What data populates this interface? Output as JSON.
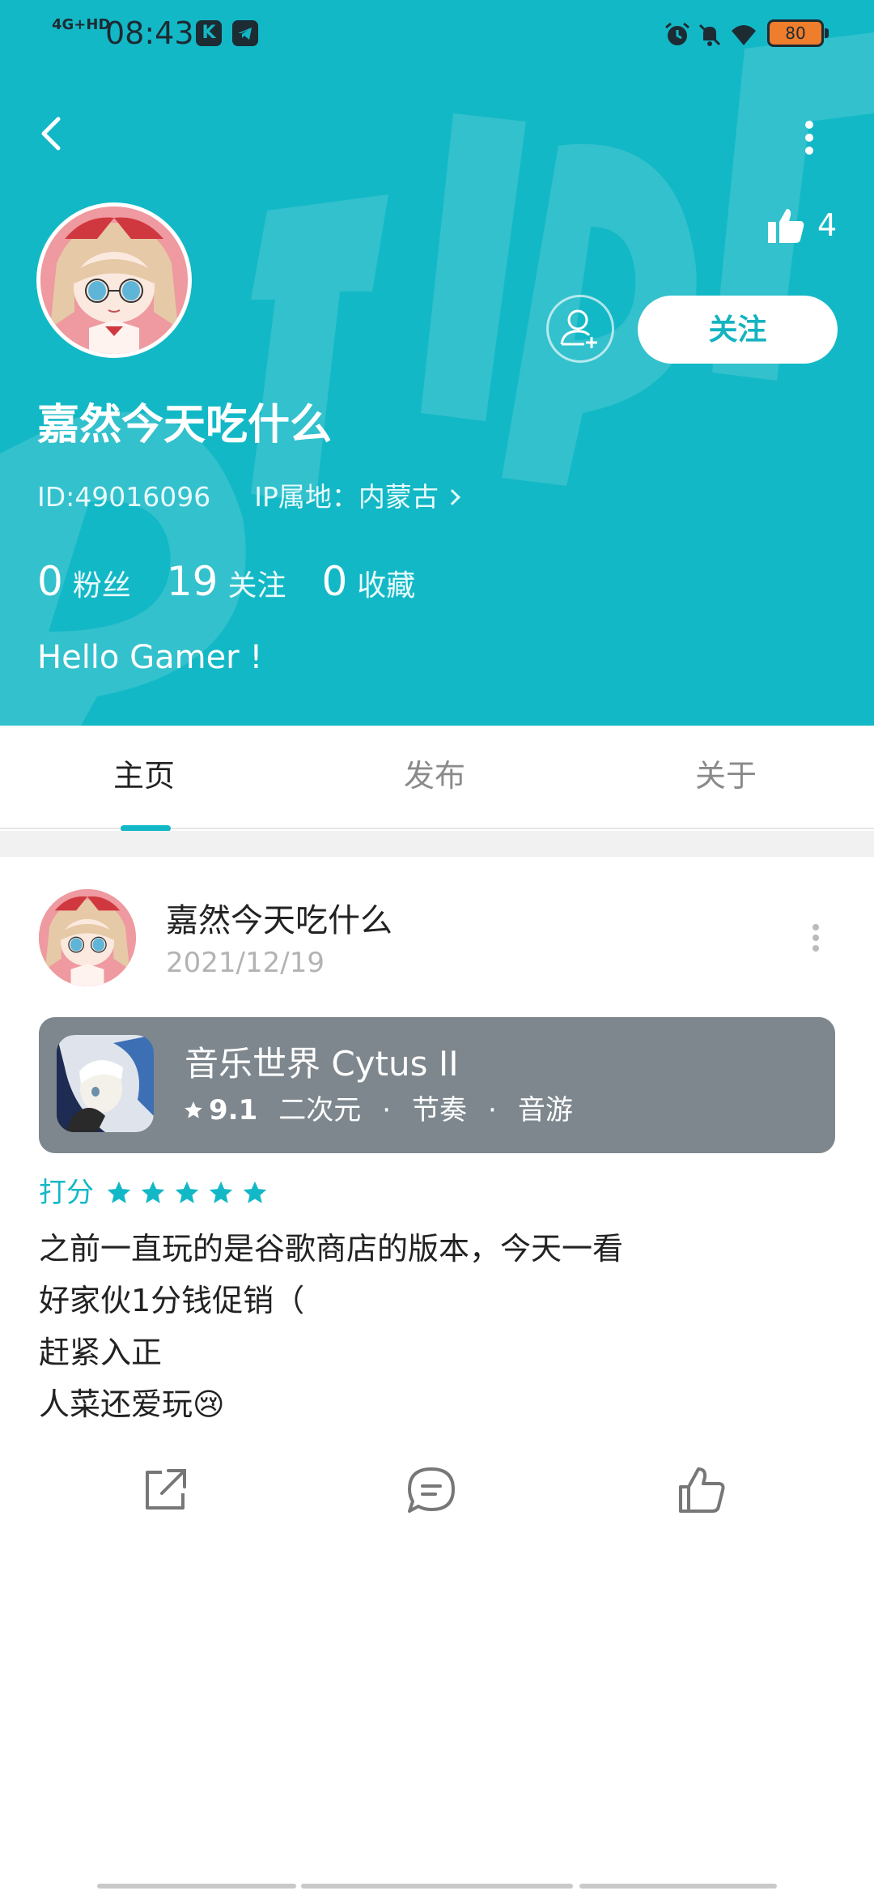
{
  "status_bar": {
    "signal": "4G+HD",
    "time": "08:43",
    "app_icon_1": "K",
    "battery": "80",
    "icons": [
      "alarm-icon",
      "mute-icon",
      "wifi-icon",
      "battery-icon"
    ]
  },
  "header": {
    "bg_color": "#13b8c6",
    "likes": "4",
    "follow_button": "关注",
    "nickname": "嘉然今天吃什么",
    "id_text": "ID:49016096",
    "ip_text": "IP属地：内蒙古",
    "stats": [
      {
        "num": "0",
        "label": "粉丝"
      },
      {
        "num": "19",
        "label": "关注"
      },
      {
        "num": "0",
        "label": "收藏"
      }
    ],
    "bio": "Hello Gamer !"
  },
  "tabs": [
    {
      "label": "主页",
      "active": true
    },
    {
      "label": "发布",
      "active": false
    },
    {
      "label": "关于",
      "active": false
    }
  ],
  "post": {
    "author": "嘉然今天吃什么",
    "date": "2021/12/19",
    "game": {
      "name": "音乐世界 Cytus II",
      "score": "9.1",
      "tags": [
        "二次元",
        "节奏",
        "音游"
      ]
    },
    "rating_label": "打分",
    "stars": 5,
    "lines": [
      "之前一直玩的是谷歌商店的版本，今天一看",
      "好家伙1分钱促销（",
      "赶紧入正",
      "人菜还爱玩"
    ],
    "emoji": "😢",
    "actions": [
      "share-icon",
      "comment-icon",
      "like-icon"
    ]
  },
  "accent_color": "#13b8c6"
}
